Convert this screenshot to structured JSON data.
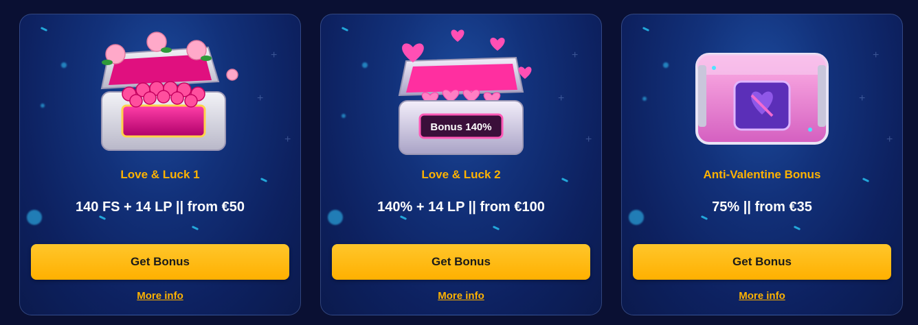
{
  "colors": {
    "page_background": "#0a1033",
    "card_background": "#12317a",
    "accent": "#ffb300",
    "button": "#ffb000",
    "text": "#ffffff"
  },
  "cards": [
    {
      "image": "rose-chest-icon",
      "title": "Love & Luck 1",
      "offer": "140 FS + 14 LP || from €50",
      "button_label": "Get Bonus",
      "link_label": "More info"
    },
    {
      "image": "heart-chest-icon",
      "image_text": "Bonus 140%",
      "title": "Love & Luck 2",
      "offer": "140% + 14 LP || from €100",
      "button_label": "Get Bonus",
      "link_label": "More info"
    },
    {
      "image": "broken-heart-chest-icon",
      "title": "Anti-Valentine Bonus",
      "offer": "75% || from €35",
      "button_label": "Get Bonus",
      "link_label": "More info"
    }
  ]
}
